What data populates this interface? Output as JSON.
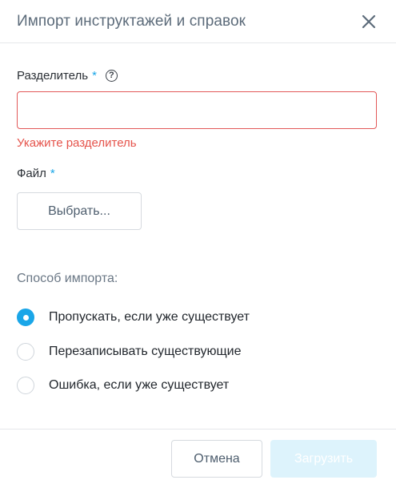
{
  "dialog": {
    "title": "Импорт инструктажей и справок",
    "close_icon": "close-icon"
  },
  "separator": {
    "label": "Разделитель",
    "required_mark": "*",
    "help_icon": "question-circle-icon",
    "help_glyph": "?",
    "value": "",
    "placeholder": "",
    "error": "Укажите разделитель"
  },
  "file": {
    "label": "Файл",
    "required_mark": "*",
    "choose_label": "Выбрать..."
  },
  "import_mode": {
    "label": "Способ импорта:",
    "options": [
      {
        "label": "Пропускать, если уже существует",
        "selected": true
      },
      {
        "label": "Перезаписывать существующие",
        "selected": false
      },
      {
        "label": "Ошибка, если уже существует",
        "selected": false
      }
    ]
  },
  "footer": {
    "cancel_label": "Отмена",
    "submit_label": "Загрузить",
    "submit_disabled": true
  },
  "colors": {
    "accent": "#1aa6e8",
    "error": "#e5534b",
    "submit_disabled_bg": "#ddf3fc"
  }
}
